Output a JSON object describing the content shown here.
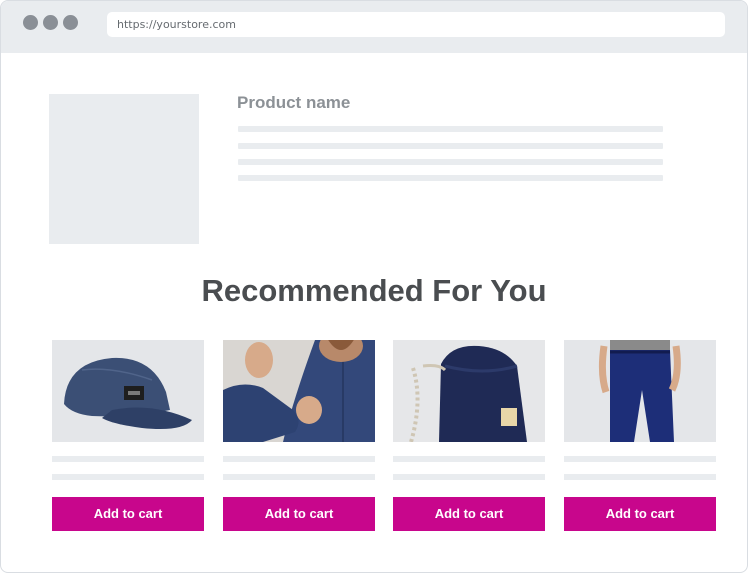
{
  "browser": {
    "url": "https://yourstore.com"
  },
  "product": {
    "name": "Product name"
  },
  "recommendations": {
    "title": "Recommended For You",
    "items": [
      {
        "image": "denim-cap-photo",
        "button_label": "Add to cart"
      },
      {
        "image": "denim-shirt-photo",
        "button_label": "Add to cart"
      },
      {
        "image": "navy-backpack-photo",
        "button_label": "Add to cart"
      },
      {
        "image": "navy-jeans-photo",
        "button_label": "Add to cart"
      }
    ]
  },
  "colors": {
    "accent": "#c8068c",
    "placeholder": "#e9ecef",
    "title_text": "#4a4d50"
  }
}
